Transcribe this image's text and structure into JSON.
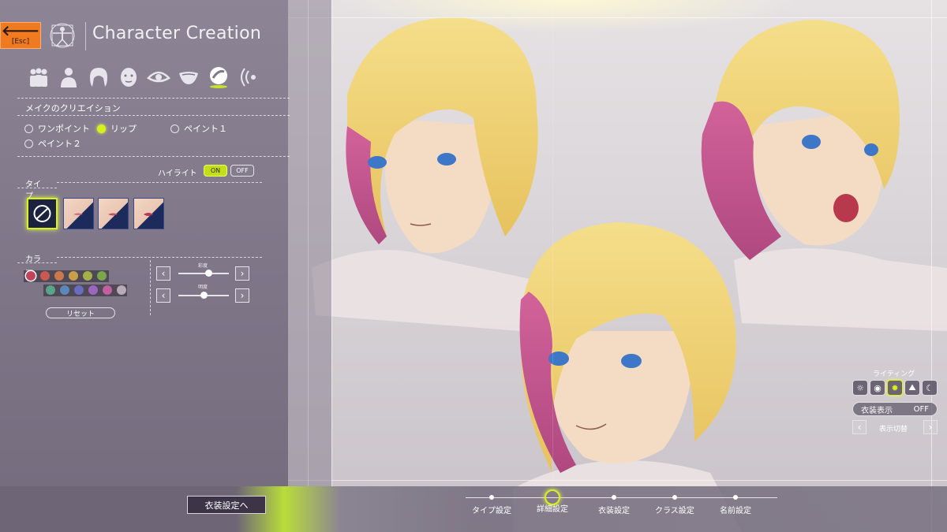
{
  "header": {
    "esc_label": "[Esc]",
    "title": "Character Creation"
  },
  "categories": [
    {
      "name": "group-icon",
      "active": false
    },
    {
      "name": "body-icon",
      "active": false
    },
    {
      "name": "hair-icon",
      "active": false
    },
    {
      "name": "face-icon",
      "active": false
    },
    {
      "name": "eye-icon",
      "active": false
    },
    {
      "name": "mouth-icon",
      "active": false
    },
    {
      "name": "makeup-icon",
      "active": true
    },
    {
      "name": "voice-icon",
      "active": false
    }
  ],
  "makeup": {
    "section_label": "メイクのクリエイション",
    "options": [
      {
        "label": "ワンポイント",
        "selected": false
      },
      {
        "label": "リップ",
        "selected": true
      },
      {
        "label": "ペイント１",
        "selected": false
      },
      {
        "label": "ペイント２",
        "selected": false
      }
    ],
    "highlight_label": "ハイライト",
    "highlight_on": "ON",
    "highlight_off": "OFF",
    "type_header": "タイプ",
    "color_header": "カラー",
    "reset_label": "リセット",
    "saturation_label": "彩度",
    "saturation_value": 0.6,
    "brightness_label": "明度",
    "brightness_value": 0.5
  },
  "swatches_row1": [
    "#c2445a",
    "#c85a50",
    "#c9794d",
    "#c9a04a",
    "#a6b04a",
    "#7aa64e"
  ],
  "swatches_row2": [
    "#5aa58a",
    "#5a88b8",
    "#6a6cc0",
    "#9a66c0",
    "#c25f9e",
    "#b8aab8"
  ],
  "lighting": {
    "label": "ライティング",
    "costume_label": "衣装表示",
    "costume_value": "OFF",
    "display_switch_label": "表示切替"
  },
  "bottom": {
    "next_label": "衣装設定へ",
    "steps": [
      {
        "label": "タイプ設定",
        "active": false
      },
      {
        "label": "詳細設定",
        "active": true
      },
      {
        "label": "衣装設定",
        "active": false
      },
      {
        "label": "クラス設定",
        "active": false
      },
      {
        "label": "名前設定",
        "active": false
      }
    ]
  },
  "colors": {
    "accent": "#d6f21a",
    "esc": "#f07a1f",
    "hair_blonde": "#f1d57a",
    "hair_pink": "#c8548c",
    "skin": "#f4dcc4"
  }
}
